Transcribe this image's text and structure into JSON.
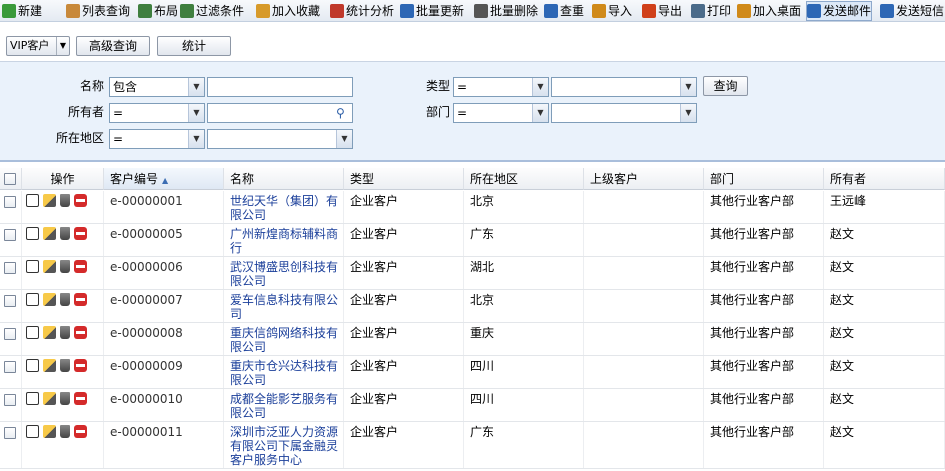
{
  "toolbar": {
    "items": [
      {
        "label": "新建",
        "icon": "new-icon",
        "color": "#3a9a3a"
      },
      {
        "label": "列表查询",
        "icon": "list-query-icon",
        "color": "#c8893b"
      },
      {
        "label": "布局",
        "icon": "layout-icon",
        "color": "#3f7f3f"
      },
      {
        "label": "过滤条件",
        "icon": "filter-icon",
        "color": "#3f7f3f"
      },
      {
        "label": "加入收藏",
        "icon": "favorite-icon",
        "color": "#d79a2a"
      },
      {
        "label": "统计分析",
        "icon": "chart-icon",
        "color": "#c0392b"
      },
      {
        "label": "批量更新",
        "icon": "batch-update-icon",
        "color": "#2d67b5"
      },
      {
        "label": "批量删除",
        "icon": "batch-delete-icon",
        "color": "#555555"
      },
      {
        "label": "查重",
        "icon": "dedupe-icon",
        "color": "#2d67b5"
      },
      {
        "label": "导入",
        "icon": "import-icon",
        "color": "#d08a1a"
      },
      {
        "label": "导出",
        "icon": "export-icon",
        "color": "#d0401a"
      },
      {
        "label": "打印",
        "icon": "print-icon",
        "color": "#4a6b8a"
      },
      {
        "label": "加入桌面",
        "icon": "desktop-icon",
        "color": "#d08a1a"
      },
      {
        "label": "发送邮件",
        "icon": "email-icon",
        "color": "#2d67b5"
      },
      {
        "label": "发送短信",
        "icon": "sms-icon",
        "color": "#2d67b5"
      }
    ]
  },
  "subbar": {
    "vip_select": "VIP客户",
    "advanced_query": "高级查询",
    "statistics": "统计"
  },
  "filters": {
    "name_label": "名称",
    "name_op": "包含",
    "owner_label": "所有者",
    "owner_op": "=",
    "region_label": "所在地区",
    "region_op": "=",
    "type_label": "类型",
    "type_op": "=",
    "type_value": "",
    "dept_label": "部门",
    "dept_op": "=",
    "query_button": "查询"
  },
  "table": {
    "headers": [
      "操作",
      "客户编号",
      "名称",
      "类型",
      "所在地区",
      "上级客户",
      "部门",
      "所有者"
    ],
    "rows": [
      {
        "id": "e-00000001",
        "name": "世纪天华（集团）有限公司",
        "type": "企业客户",
        "region": "北京",
        "parent": "",
        "dept": "其他行业客户部",
        "owner": "王远峰"
      },
      {
        "id": "e-00000005",
        "name": "广州新煌商标辅料商行",
        "type": "企业客户",
        "region": "广东",
        "parent": "",
        "dept": "其他行业客户部",
        "owner": "赵文"
      },
      {
        "id": "e-00000006",
        "name": "武汉博盛思创科技有限公司",
        "type": "企业客户",
        "region": "湖北",
        "parent": "",
        "dept": "其他行业客户部",
        "owner": "赵文"
      },
      {
        "id": "e-00000007",
        "name": "爱车信息科技有限公司",
        "type": "企业客户",
        "region": "北京",
        "parent": "",
        "dept": "其他行业客户部",
        "owner": "赵文"
      },
      {
        "id": "e-00000008",
        "name": "重庆信鸽网络科技有限公司",
        "type": "企业客户",
        "region": "重庆",
        "parent": "",
        "dept": "其他行业客户部",
        "owner": "赵文"
      },
      {
        "id": "e-00000009",
        "name": "重庆市仓兴达科技有限公司",
        "type": "企业客户",
        "region": "四川",
        "parent": "",
        "dept": "其他行业客户部",
        "owner": "赵文"
      },
      {
        "id": "e-00000010",
        "name": "成都全能影艺服务有限公司",
        "type": "企业客户",
        "region": "四川",
        "parent": "",
        "dept": "其他行业客户部",
        "owner": "赵文"
      },
      {
        "id": "e-00000011",
        "name": "深圳市泛亚人力资源有限公司下属金融灵客户服务中心",
        "type": "企业客户",
        "region": "广东",
        "parent": "",
        "dept": "其他行业客户部",
        "owner": "赵文"
      }
    ]
  },
  "colors": {
    "toolbar_bg": "#e4eaf2",
    "filter_bg": "#eaf2fb",
    "link": "#1b3f9a",
    "accent": "#3b6db3"
  }
}
